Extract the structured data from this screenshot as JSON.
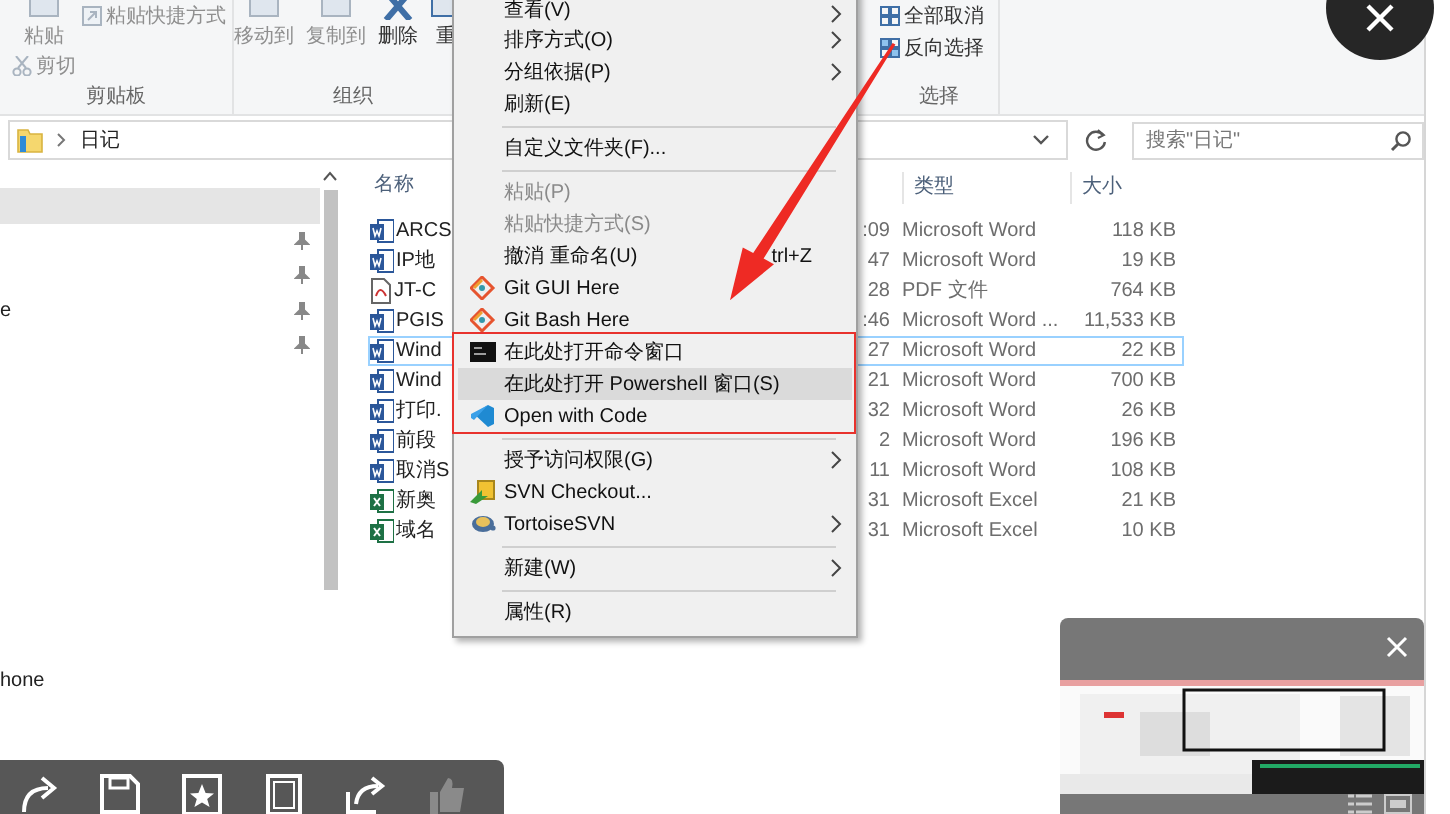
{
  "ribbon": {
    "groups": [
      {
        "label": "剪贴板",
        "commands": [
          {
            "label": "粘贴",
            "kind": "large",
            "disabled": true
          },
          {
            "label": "剪切",
            "kind": "small",
            "disabled": true
          },
          {
            "label": "粘贴快捷方式",
            "kind": "small",
            "disabled": true
          }
        ]
      },
      {
        "label": "组织",
        "commands": [
          {
            "label": "移动到",
            "kind": "large",
            "disabled": true
          },
          {
            "label": "复制到",
            "kind": "large",
            "disabled": true
          },
          {
            "label": "删除",
            "kind": "large",
            "disabled": false
          },
          {
            "label": "重",
            "kind": "large",
            "disabled": false
          }
        ]
      },
      {
        "label": "选择",
        "commands": [
          {
            "label": "全部取消",
            "kind": "small",
            "disabled": false
          },
          {
            "label": "反向选择",
            "kind": "small",
            "disabled": false
          }
        ]
      }
    ]
  },
  "address": {
    "path": "日记"
  },
  "search": {
    "placeholder": "搜索\"日记\""
  },
  "nav": {
    "items": [
      {
        "selected": true,
        "pinned": false
      },
      {
        "selected": false,
        "pinned": true
      },
      {
        "selected": false,
        "pinned": true
      },
      {
        "label": "e",
        "selected": false,
        "pinned": true
      },
      {
        "selected": false,
        "pinned": true
      }
    ],
    "lower_items": [
      {
        "label": "hone",
        "selected": false
      }
    ]
  },
  "files": {
    "columns": [
      "名称",
      "类型",
      "大小"
    ],
    "rows": [
      {
        "kind": "word",
        "name": "ARCS",
        "column_2": ":09",
        "type": "Microsoft Word",
        "size": "118 KB",
        "selected": false
      },
      {
        "kind": "word",
        "name": "IP地",
        "column_2": "47",
        "type": "Microsoft Word",
        "size": "19 KB",
        "selected": false
      },
      {
        "kind": "pdf",
        "name": "JT-C",
        "column_2": "28",
        "type": "PDF 文件",
        "size": "764 KB",
        "selected": false
      },
      {
        "kind": "word",
        "name": "PGIS",
        "column_2": ":46",
        "type": "Microsoft Word ...",
        "size": "11,533 KB",
        "selected": false
      },
      {
        "kind": "word",
        "name": "Wind",
        "column_2": "27",
        "type": "Microsoft Word",
        "size": "22 KB",
        "selected": true
      },
      {
        "kind": "word",
        "name": "Wind",
        "column_2": "21",
        "type": "Microsoft Word",
        "size": "700 KB",
        "selected": false
      },
      {
        "kind": "word",
        "name": "打印.",
        "column_2": "32",
        "type": "Microsoft Word",
        "size": "26 KB",
        "selected": false
      },
      {
        "kind": "word",
        "name": "前段",
        "column_2": "2",
        "type": "Microsoft Word",
        "size": "196 KB",
        "selected": false
      },
      {
        "kind": "word",
        "name": "取消S",
        "column_2": "11",
        "type": "Microsoft Word",
        "size": "108 KB",
        "selected": false
      },
      {
        "kind": "excel",
        "name": "新奥",
        "column_2": "31",
        "type": "Microsoft Excel",
        "size": "21 KB",
        "selected": false
      },
      {
        "kind": "excel",
        "name": "域名",
        "column_2": "31",
        "type": "Microsoft Excel",
        "size": "10 KB",
        "selected": false
      }
    ]
  },
  "context_menu": {
    "items": [
      {
        "kind": "text",
        "label": "查看(V)",
        "submenu": true,
        "disabled": false,
        "selected": false
      },
      {
        "kind": "text",
        "label": "排序方式(O)",
        "submenu": true,
        "disabled": false,
        "selected": false
      },
      {
        "kind": "text",
        "label": "分组依据(P)",
        "submenu": true,
        "disabled": false,
        "selected": false
      },
      {
        "kind": "text",
        "label": "刷新(E)",
        "submenu": false,
        "disabled": false,
        "selected": false
      },
      {
        "kind": "separator"
      },
      {
        "kind": "text",
        "label": "自定义文件夹(F)...",
        "submenu": false,
        "disabled": false,
        "selected": false
      },
      {
        "kind": "separator"
      },
      {
        "kind": "text",
        "label": "粘贴(P)",
        "submenu": false,
        "disabled": true,
        "selected": false
      },
      {
        "kind": "text",
        "label": "粘贴快捷方式(S)",
        "submenu": false,
        "disabled": true,
        "selected": false
      },
      {
        "kind": "text",
        "label": "撤消 重命名(U)",
        "shortcut": "trl+Z",
        "submenu": false,
        "disabled": false,
        "selected": false
      },
      {
        "kind": "git",
        "label": "Git GUI Here",
        "submenu": false,
        "disabled": false,
        "selected": false
      },
      {
        "kind": "git",
        "label": "Git Bash Here",
        "submenu": false,
        "disabled": false,
        "selected": false
      },
      {
        "kind": "console",
        "label": "在此处打开命令窗口",
        "submenu": false,
        "disabled": false,
        "selected": false
      },
      {
        "kind": "text",
        "label": "在此处打开 Powershell 窗口(S)",
        "submenu": false,
        "disabled": false,
        "selected": true
      },
      {
        "kind": "code",
        "label": "Open with Code",
        "submenu": false,
        "disabled": false,
        "selected": false
      },
      {
        "kind": "separator"
      },
      {
        "kind": "text",
        "label": "授予访问权限(G)",
        "submenu": true,
        "disabled": false,
        "selected": false
      },
      {
        "kind": "svn",
        "label": "SVN Checkout...",
        "submenu": false,
        "disabled": false,
        "selected": false
      },
      {
        "kind": "tortoise",
        "label": "TortoiseSVN",
        "submenu": true,
        "disabled": false,
        "selected": false
      },
      {
        "kind": "separator"
      },
      {
        "kind": "text",
        "label": "新建(W)",
        "submenu": true,
        "disabled": false,
        "selected": false
      },
      {
        "kind": "separator"
      },
      {
        "kind": "text",
        "label": "属性(R)",
        "submenu": false,
        "disabled": false,
        "selected": false
      }
    ]
  },
  "viewer_toolbar": {
    "buttons": [
      {
        "kind": "rotate",
        "disabled": false
      },
      {
        "kind": "save",
        "disabled": false
      },
      {
        "kind": "favorite",
        "disabled": false
      },
      {
        "kind": "frame",
        "disabled": false
      },
      {
        "kind": "share",
        "disabled": false
      },
      {
        "kind": "like",
        "disabled": true
      }
    ]
  }
}
